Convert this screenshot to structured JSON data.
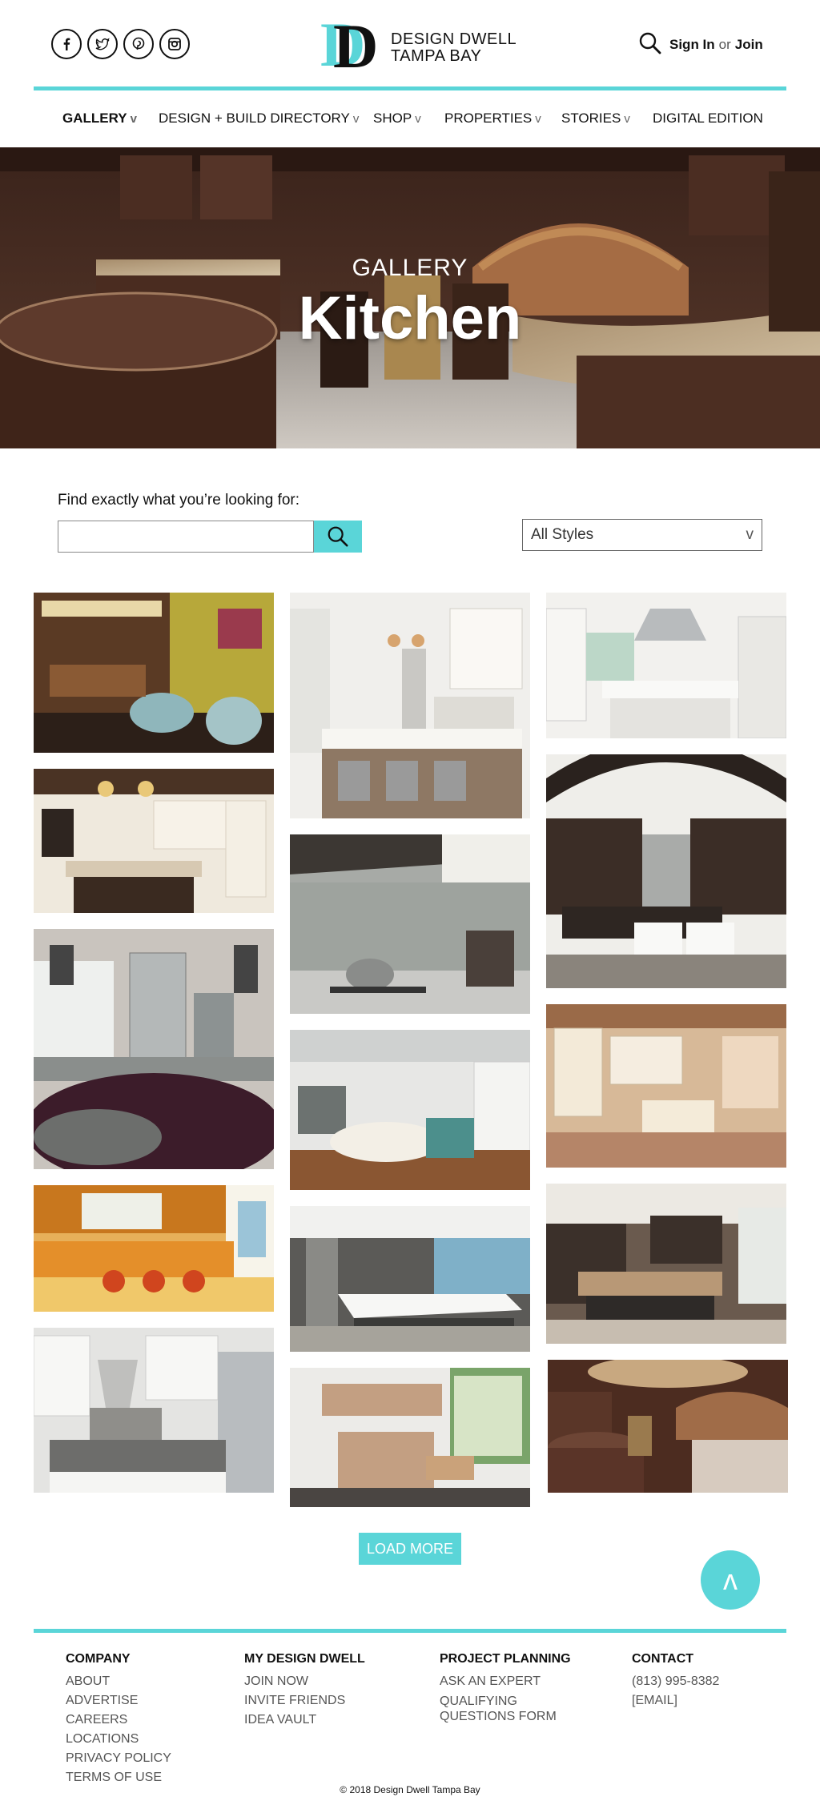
{
  "header": {
    "logo": {
      "letters": "DD",
      "line1": "DESIGN DWELL",
      "line2": "TAMPA BAY"
    },
    "social_icons": [
      "facebook-icon",
      "twitter-icon",
      "pinterest-icon",
      "instagram-icon"
    ],
    "sign_in_label": "Sign In",
    "or_label": "or",
    "join_label": "Join"
  },
  "nav": {
    "items": [
      {
        "label": "GALLERY",
        "caret": "v"
      },
      {
        "label": "DESIGN + BUILD DIRECTORY",
        "caret": "v"
      },
      {
        "label": "SHOP",
        "caret": "v"
      },
      {
        "label": "PROPERTIES",
        "caret": "v"
      },
      {
        "label": "STORIES",
        "caret": "v"
      },
      {
        "label": "DIGITAL EDITION",
        "caret": ""
      }
    ],
    "active": "GALLERY"
  },
  "hero": {
    "label": "GALLERY",
    "title": "Kitchen"
  },
  "search": {
    "prompt": "Find exactly what you’re looking for:",
    "value": "",
    "placeholder": "",
    "style_filter": "All Styles",
    "style_caret": "v"
  },
  "gallery": {
    "count": 16
  },
  "actions": {
    "load_more": "LOAD MORE",
    "to_top": "ʌ"
  },
  "footer": {
    "columns": [
      {
        "heading": "COMPANY",
        "links": [
          "ABOUT",
          "ADVERTISE",
          "CAREERS",
          "LOCATIONS",
          "PRIVACY POLICY",
          "TERMS OF USE"
        ]
      },
      {
        "heading": "MY DESIGN DWELL",
        "links": [
          "JOIN NOW",
          "INVITE FRIENDS",
          "IDEA VAULT"
        ]
      },
      {
        "heading": "PROJECT PLANNING",
        "links": [
          "ASK AN EXPERT",
          "QUALIFYING",
          "QUESTIONS FORM"
        ]
      },
      {
        "heading": "CONTACT",
        "links": [
          "(813) 995-8382",
          "[EMAIL]"
        ]
      }
    ],
    "copyright": "© 2018 Design Dwell Tampa Bay"
  },
  "colors": {
    "accent": "#5ad5d8",
    "text": "#111111",
    "muted": "#555555"
  }
}
